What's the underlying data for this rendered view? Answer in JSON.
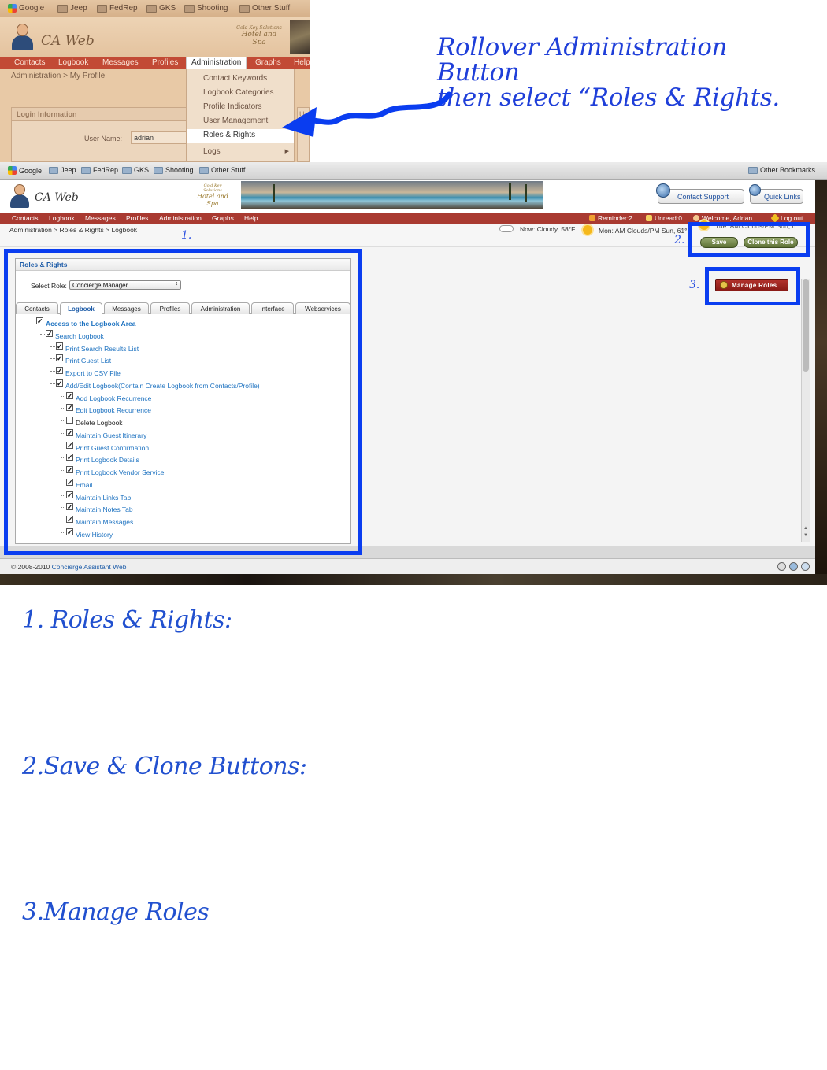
{
  "instruction": {
    "line1": "Rollover Administration Button",
    "line2": "then select “Roles & Rights."
  },
  "shot1": {
    "bookmarks": [
      "Google",
      "Jeep",
      "FedRep",
      "GKS",
      "Shooting",
      "Other Stuff"
    ],
    "app_title": "CA Web",
    "brand_small": "Gold Key Solutions",
    "brand_big": "Hotel and Spa",
    "nav": [
      "Contacts",
      "Logbook",
      "Messages",
      "Profiles",
      "Administration",
      "Graphs",
      "Help"
    ],
    "breadcrumb": "Administration > My Profile",
    "login_title": "Login Information",
    "username_label": "User Name:",
    "username_value": "adrian",
    "u_label": "U",
    "admin_menu": [
      "Contact Keywords",
      "Logbook Categories",
      "Profile Indicators",
      "User Management",
      "Roles & Rights",
      "Logs"
    ],
    "highlighted_item": "Roles & Rights"
  },
  "shot2": {
    "bookmarks": [
      "Google",
      "Jeep",
      "FedRep",
      "GKS",
      "Shooting",
      "Other Stuff"
    ],
    "other_bookmarks": "Other Bookmarks",
    "app_title": "CA Web",
    "brand_small": "Gold Key Solutions",
    "brand_big": "Hotel and Spa",
    "contact_support": "Contact Support",
    "quick_links": "Quick Links",
    "nav": [
      "Contacts",
      "Logbook",
      "Messages",
      "Profiles",
      "Administration",
      "Graphs",
      "Help"
    ],
    "status": {
      "reminder": "Reminder:2",
      "unread": "Unread:0",
      "welcome": "Welcome, Adrian L.",
      "logout": "Log out"
    },
    "breadcrumb": "Administration > Roles & Rights > Logbook",
    "weather_now": "Now: Cloudy, 58°F",
    "weather_mon": "Mon: AM Clouds/PM Sun, 61°",
    "weather_tue": "Tue: AM Clouds/PM Sun, 6",
    "save_label": "Save",
    "clone_label": "Clone this Role",
    "manage_roles_label": "Manage Roles",
    "roles_title": "Roles & Rights",
    "select_role_label": "Select Role:",
    "selected_role": "Concierge Manager",
    "tabs": [
      "Contacts",
      "Logbook",
      "Messages",
      "Profiles",
      "Administration",
      "Interface",
      "Webservices"
    ],
    "active_tab": "Logbook",
    "tree": [
      {
        "label": "Access to the Logbook Area",
        "level": 0,
        "checked": true,
        "bold": true
      },
      {
        "label": "Search Logbook",
        "level": 1,
        "checked": true
      },
      {
        "label": "Print Search Results List",
        "level": 2,
        "checked": true
      },
      {
        "label": "Print Guest List",
        "level": 2,
        "checked": true
      },
      {
        "label": "Export to CSV File",
        "level": 2,
        "checked": true
      },
      {
        "label": "Add/Edit Logbook(Contain Create Logbook from Contacts/Profile)",
        "level": 2,
        "checked": true
      },
      {
        "label": "Add Logbook Recurrence",
        "level": 3,
        "checked": true
      },
      {
        "label": "Edit Logbook Recurrence",
        "level": 3,
        "checked": true
      },
      {
        "label": "Delete Logbook",
        "level": 3,
        "checked": false
      },
      {
        "label": "Maintain Guest Itinerary",
        "level": 3,
        "checked": true
      },
      {
        "label": "Print Guest Confirmation",
        "level": 3,
        "checked": true
      },
      {
        "label": "Print Logbook Details",
        "level": 3,
        "checked": true
      },
      {
        "label": "Print Logbook Vendor Service",
        "level": 3,
        "checked": true
      },
      {
        "label": "Email",
        "level": 3,
        "checked": true
      },
      {
        "label": "Maintain Links Tab",
        "level": 3,
        "checked": true
      },
      {
        "label": "Maintain Notes Tab",
        "level": 3,
        "checked": true
      },
      {
        "label": "Maintain Messages",
        "level": 3,
        "checked": true
      },
      {
        "label": "View History",
        "level": 3,
        "checked": true
      }
    ],
    "footer_prefix": "© 2008-2010 ",
    "footer_link": "Concierge Assistant Web",
    "markers": [
      "1.",
      "2.",
      "3."
    ]
  },
  "sections": [
    "1. Roles & Rights:",
    "2.Save & Clone Buttons:",
    "3.Manage Roles"
  ],
  "colors": {
    "annotation_blue": "#0a3df0",
    "nav_red": "#a93a31",
    "link_blue": "#1d72c0",
    "save_green": "#5e7236",
    "manage_red": "#8a1a16"
  }
}
